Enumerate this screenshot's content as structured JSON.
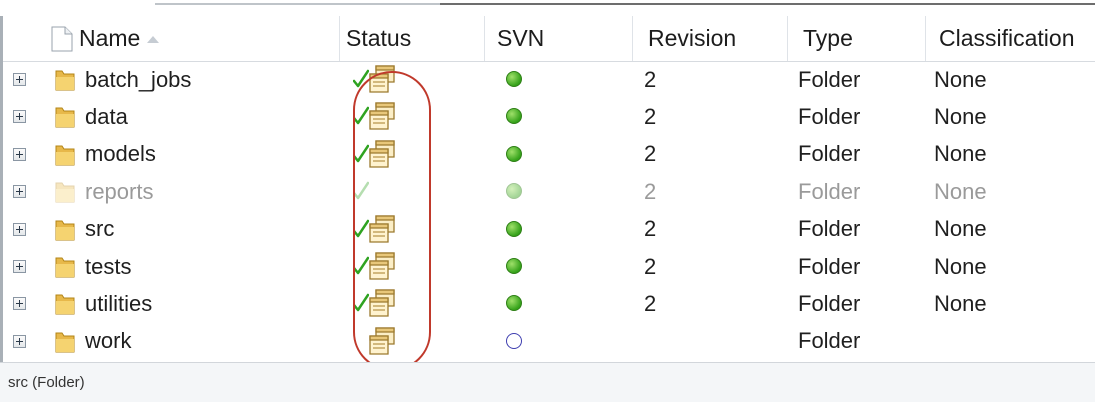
{
  "columns": [
    {
      "label": "Name",
      "sort": "ascending"
    },
    {
      "label": "Status"
    },
    {
      "label": "SVN"
    },
    {
      "label": "Revision"
    },
    {
      "label": "Type"
    },
    {
      "label": "Classification"
    }
  ],
  "rows": [
    {
      "name": "batch_jobs",
      "status_icons": [
        "check-icon",
        "properties-icon"
      ],
      "svn_status": "ok",
      "revision": "2",
      "type": "Folder",
      "classification": "None",
      "dimmed": false
    },
    {
      "name": "data",
      "status_icons": [
        "check-icon",
        "properties-icon"
      ],
      "svn_status": "ok",
      "revision": "2",
      "type": "Folder",
      "classification": "None",
      "dimmed": false
    },
    {
      "name": "models",
      "status_icons": [
        "check-icon",
        "properties-icon"
      ],
      "svn_status": "ok",
      "revision": "2",
      "type": "Folder",
      "classification": "None",
      "dimmed": false
    },
    {
      "name": "reports",
      "status_icons": [
        "check-icon"
      ],
      "svn_status": "ok",
      "revision": "2",
      "type": "Folder",
      "classification": "None",
      "dimmed": true
    },
    {
      "name": "src",
      "status_icons": [
        "check-icon",
        "properties-icon"
      ],
      "svn_status": "ok",
      "revision": "2",
      "type": "Folder",
      "classification": "None",
      "dimmed": false
    },
    {
      "name": "tests",
      "status_icons": [
        "check-icon",
        "properties-icon"
      ],
      "svn_status": "ok",
      "revision": "2",
      "type": "Folder",
      "classification": "None",
      "dimmed": false
    },
    {
      "name": "utilities",
      "status_icons": [
        "check-icon",
        "properties-icon"
      ],
      "svn_status": "ok",
      "revision": "2",
      "type": "Folder",
      "classification": "None",
      "dimmed": false
    },
    {
      "name": "work",
      "status_icons": [
        "properties-icon"
      ],
      "svn_status": "unversioned",
      "revision": "",
      "type": "Folder",
      "classification": "",
      "dimmed": false
    }
  ],
  "status_bar": {
    "text": "src (Folder)"
  },
  "annotation": {
    "color": "#c0392b"
  }
}
